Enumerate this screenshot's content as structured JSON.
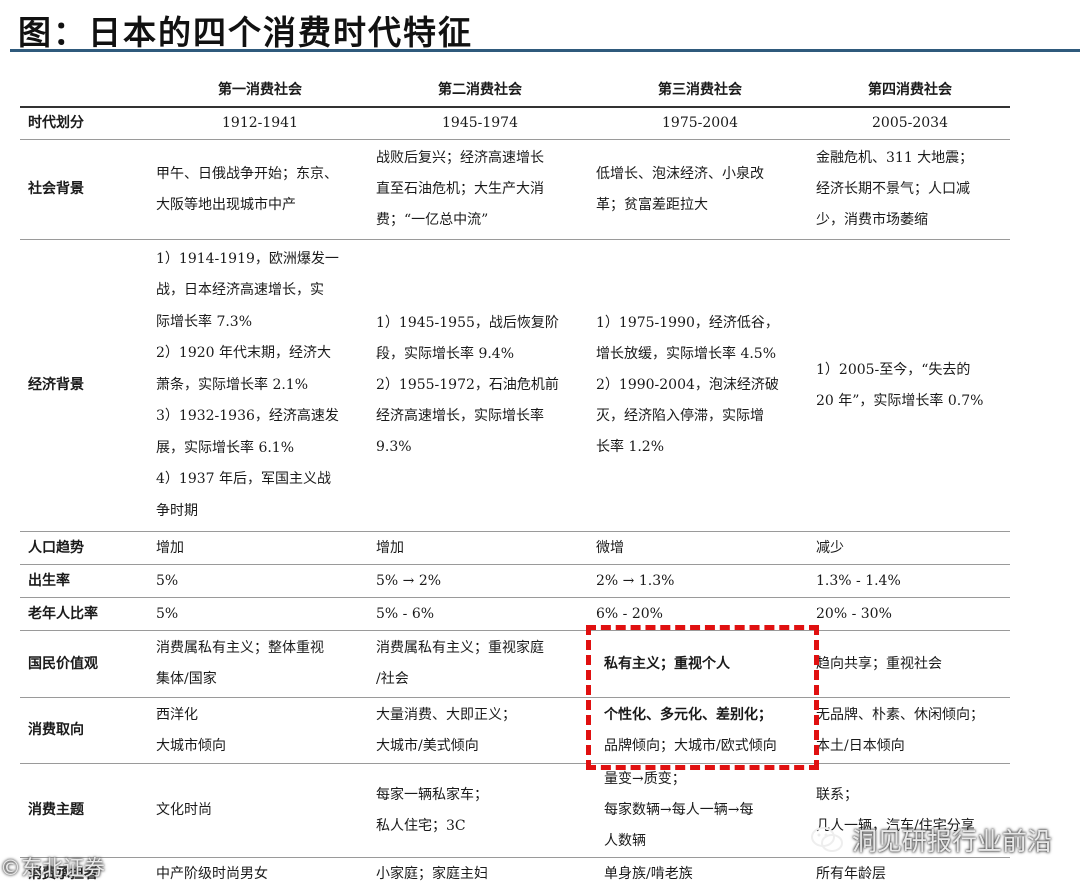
{
  "title": "图：日本的四个消费时代特征",
  "columns": [
    "",
    "第一消费社会",
    "第二消费社会",
    "第三消费社会",
    "第四消费社会"
  ],
  "rows": [
    {
      "label": "时代划分",
      "cells": [
        "1912-1941",
        "1945-1974",
        "1975-2004",
        "2005-2034"
      ]
    },
    {
      "label": "社会背景",
      "cells": [
        "甲午、日俄战争开始；东京、\n大阪等地出现城市中产",
        "战败后复兴；经济高速增长\n直至石油危机；大生产大消\n费；“一亿总中流”",
        "低增长、泡沫经济、小泉改\n革；贫富差距拉大",
        "金融危机、311 大地震；\n经济长期不景气；人口减\n少，消费市场萎缩"
      ]
    },
    {
      "label": "经济背景",
      "cells": [
        "1）1914-1919，欧洲爆发一\n战，日本经济高速增长，实\n际增长率 7.3%\n2）1920 年代末期，经济大\n萧条，实际增长率 2.1%\n3）1932-1936，经济高速发\n展，实际增长率 6.1%\n4）1937 年后，军国主义战\n争时期",
        "1）1945-1955，战后恢复阶\n段，实际增长率 9.4%\n2）1955-1972，石油危机前\n经济高速增长，实际增长率\n9.3%",
        "1）1975-1990，经济低谷，\n增长放缓，实际增长率 4.5%\n2）1990-2004，泡沫经济破\n灭，经济陷入停滞，实际增\n长率 1.2%",
        "1）2005-至今，“失去的\n20 年”，实际增长率 0.7%"
      ]
    },
    {
      "label": "人口趋势",
      "cells": [
        "增加",
        "增加",
        "微增",
        "减少"
      ]
    },
    {
      "label": "出生率",
      "cells": [
        "5%",
        "5% → 2%",
        "2% → 1.3%",
        "1.3% - 1.4%"
      ]
    },
    {
      "label": "老年人比率",
      "cells": [
        "5%",
        "5% - 6%",
        "6% - 20%",
        "20% - 30%"
      ]
    },
    {
      "label": "国民价值观",
      "cells": [
        "消费属私有主义；整体重视\n集体/国家",
        "消费属私有主义；重视家庭\n/社会",
        "私有主义；重视个人",
        "趋向共享；重视社会"
      ]
    },
    {
      "label": "消费取向",
      "cells": [
        "西洋化\n大城市倾向",
        "大量消费、大即正义；\n大城市/美式倾向",
        "个性化、多元化、差别化；\n品牌倾向；大城市/欧式倾向",
        "无品牌、朴素、休闲倾向；\n本土/日本倾向"
      ]
    },
    {
      "label": "消费主题",
      "cells": [
        "文化时尚",
        "每家一辆私家车；\n私人住宅；3C",
        "量变→质变；\n每家数辆→每人一辆→每\n人数辆",
        "联系；\n几人一辆，汽车/住宅分享"
      ]
    },
    {
      "label": "消费承担者",
      "cells": [
        "中产阶级时尚男女",
        "小家庭；家庭主妇",
        "单身族/啃老族",
        "所有年龄层"
      ]
    }
  ],
  "watermark": {
    "right": "洞见研报行业前沿",
    "left": "©东北证券"
  },
  "colors": {
    "rule": "#2f5a7c",
    "highlight": "#e01010"
  }
}
